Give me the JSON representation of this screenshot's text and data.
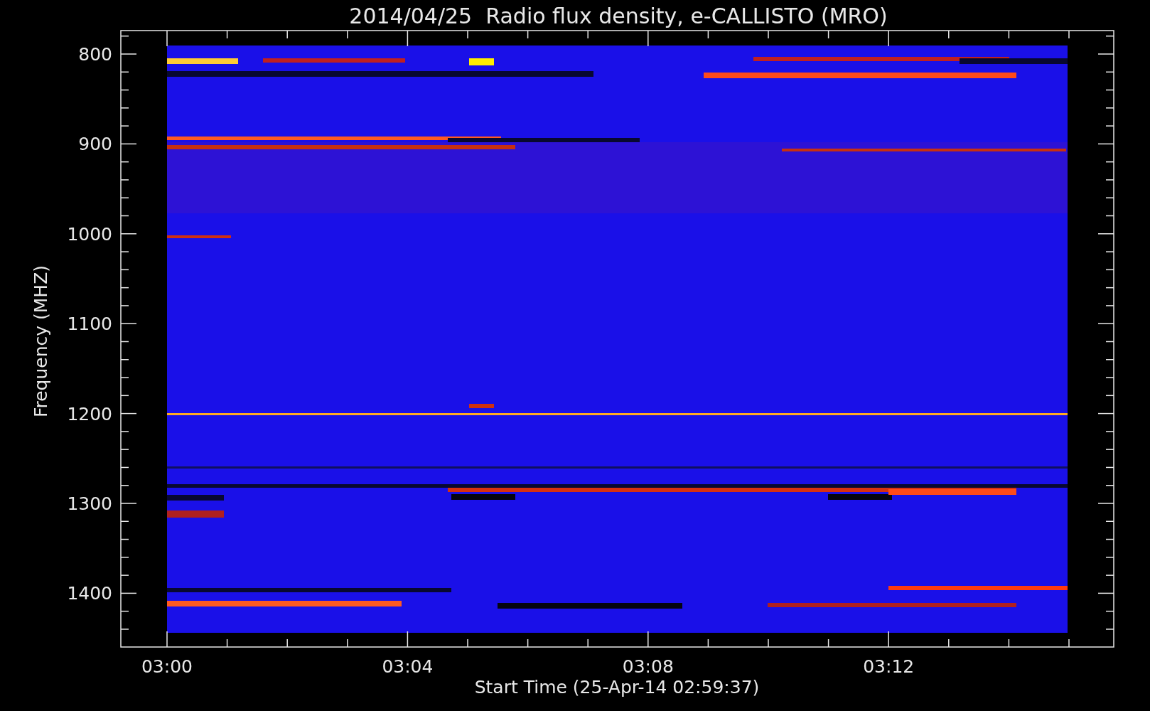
{
  "title": "2014/04/25  Radio flux density, e-CALLISTO (MRO)",
  "y_axis": {
    "label": "Frequency (MHZ)",
    "ticks": [
      "800",
      "900",
      "1000",
      "1100",
      "1200",
      "1300",
      "1400"
    ]
  },
  "x_axis": {
    "label": "Start Time (25-Apr-14 02:59:37)",
    "ticks": [
      "03:00",
      "03:04",
      "03:08",
      "03:12"
    ]
  }
}
